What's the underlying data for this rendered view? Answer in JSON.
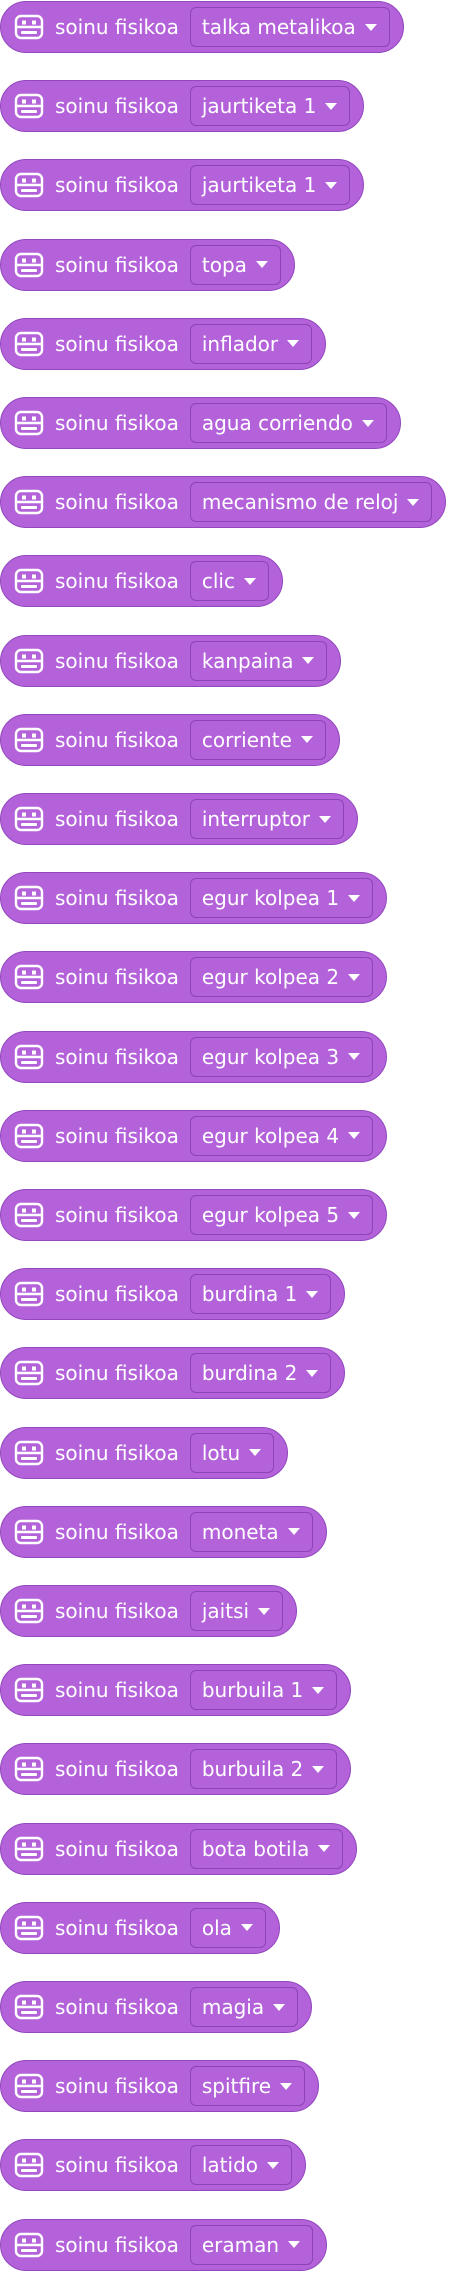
{
  "block_label": "soinu fisikoa",
  "icon": "soundcard-icon",
  "colors": {
    "block": "#b462da",
    "border": "#9247bd",
    "text": "#ffffff"
  },
  "blocks": [
    {
      "option": "talka metalikoa"
    },
    {
      "option": "jaurtiketa 1"
    },
    {
      "option": "jaurtiketa 1"
    },
    {
      "option": "topa"
    },
    {
      "option": "inflador"
    },
    {
      "option": "agua corriendo"
    },
    {
      "option": "mecanismo de reloj"
    },
    {
      "option": "clic"
    },
    {
      "option": "kanpaina"
    },
    {
      "option": "corriente"
    },
    {
      "option": "interruptor"
    },
    {
      "option": "egur kolpea 1"
    },
    {
      "option": "egur kolpea 2"
    },
    {
      "option": "egur kolpea 3"
    },
    {
      "option": "egur kolpea 4"
    },
    {
      "option": "egur kolpea 5"
    },
    {
      "option": "burdina 1"
    },
    {
      "option": "burdina 2"
    },
    {
      "option": "lotu"
    },
    {
      "option": "moneta"
    },
    {
      "option": "jaitsi"
    },
    {
      "option": "burbuila 1"
    },
    {
      "option": "burbuila 2"
    },
    {
      "option": "bota botila"
    },
    {
      "option": "ola"
    },
    {
      "option": "magia"
    },
    {
      "option": "spitfire"
    },
    {
      "option": "latido"
    },
    {
      "option": "eraman"
    }
  ]
}
